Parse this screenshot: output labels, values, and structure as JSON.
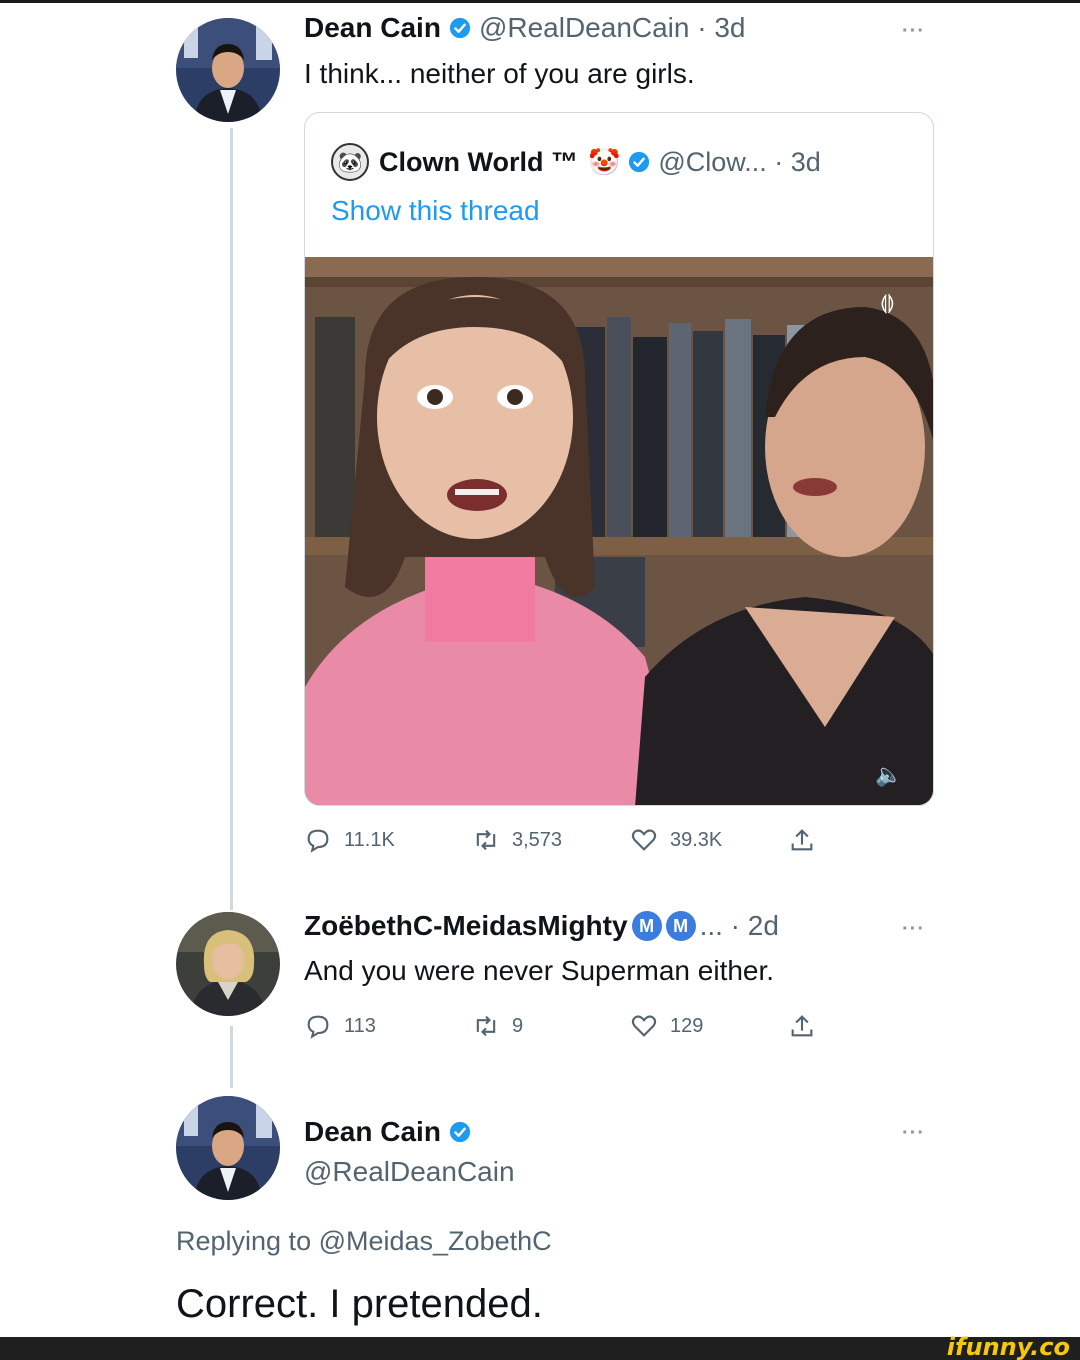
{
  "tweet1": {
    "name": "Dean Cain",
    "handle_time": "@RealDeanCain · 3d",
    "text": "I think... neither of you are girls.",
    "more": "···",
    "quote": {
      "avatar_glyph": "🐼",
      "name": "Clown World ™",
      "emoji": "🤡",
      "handle_time": "@Clow... · 3d",
      "show_thread": "Show this thread"
    },
    "actions": {
      "replies": "11.1K",
      "retweets": "3,573",
      "likes": "39.3K"
    }
  },
  "tweet2": {
    "name": "ZoëbethC-MeidasMighty",
    "badge1": "M",
    "badge2": "M",
    "handle_time": "... · 2d",
    "text": "And you were never Superman either.",
    "more": "···",
    "actions": {
      "replies": "113",
      "retweets": "9",
      "likes": "129"
    }
  },
  "tweet3": {
    "name": "Dean Cain",
    "handle": "@RealDeanCain",
    "more": "···",
    "replying_prefix": "Replying to ",
    "replying_handle": "@Meidas_ZobethC",
    "text": "Correct. I pretended."
  },
  "watermark": "ifunny.co",
  "colors": {
    "verified": "#1d9bf0",
    "link": "#1d9bf0",
    "meidas_badge": "#3b7ddd",
    "muted": "#536471"
  }
}
